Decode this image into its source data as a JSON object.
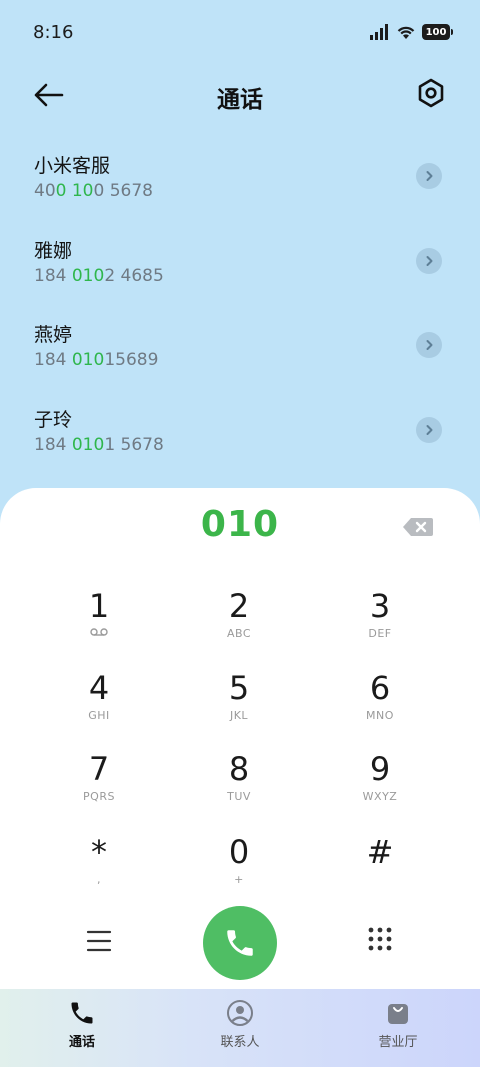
{
  "status_bar": {
    "time": "8:16",
    "battery": "100"
  },
  "header": {
    "title": "通话"
  },
  "contacts": [
    {
      "name": "小米客服",
      "number_parts": [
        {
          "text": "40",
          "hl": false
        },
        {
          "text": "0 10",
          "hl": true
        },
        {
          "text": "0 5678",
          "hl": false
        }
      ]
    },
    {
      "name": "雅娜",
      "number_parts": [
        {
          "text": "184 ",
          "hl": false
        },
        {
          "text": "010",
          "hl": true
        },
        {
          "text": "2 4685",
          "hl": false
        }
      ]
    },
    {
      "name": "燕婷",
      "number_parts": [
        {
          "text": "184 ",
          "hl": false
        },
        {
          "text": "010",
          "hl": true
        },
        {
          "text": "15689",
          "hl": false
        }
      ]
    },
    {
      "name": "子玲",
      "number_parts": [
        {
          "text": "184 ",
          "hl": false
        },
        {
          "text": "010",
          "hl": true
        },
        {
          "text": "1 5678",
          "hl": false
        }
      ]
    }
  ],
  "dialer": {
    "dialed_number": "010",
    "keys": [
      {
        "digit": "1",
        "sub": "voicemail-icon"
      },
      {
        "digit": "2",
        "sub": "ABC"
      },
      {
        "digit": "3",
        "sub": "DEF"
      },
      {
        "digit": "4",
        "sub": "GHI"
      },
      {
        "digit": "5",
        "sub": "JKL"
      },
      {
        "digit": "6",
        "sub": "MNO"
      },
      {
        "digit": "7",
        "sub": "PQRS"
      },
      {
        "digit": "8",
        "sub": "TUV"
      },
      {
        "digit": "9",
        "sub": "WXYZ"
      },
      {
        "digit": "*",
        "sub": ","
      },
      {
        "digit": "0",
        "sub": "+"
      },
      {
        "digit": "#",
        "sub": ""
      }
    ]
  },
  "tabs": [
    {
      "label": "通话",
      "icon": "phone-icon",
      "active": true
    },
    {
      "label": "联系人",
      "icon": "person-icon",
      "active": false
    },
    {
      "label": "营业厅",
      "icon": "shopping-bag-icon",
      "active": false
    }
  ],
  "colors": {
    "accent_green": "#3cb54a",
    "call_button": "#4fbe64",
    "background": "#bfe3f8"
  }
}
